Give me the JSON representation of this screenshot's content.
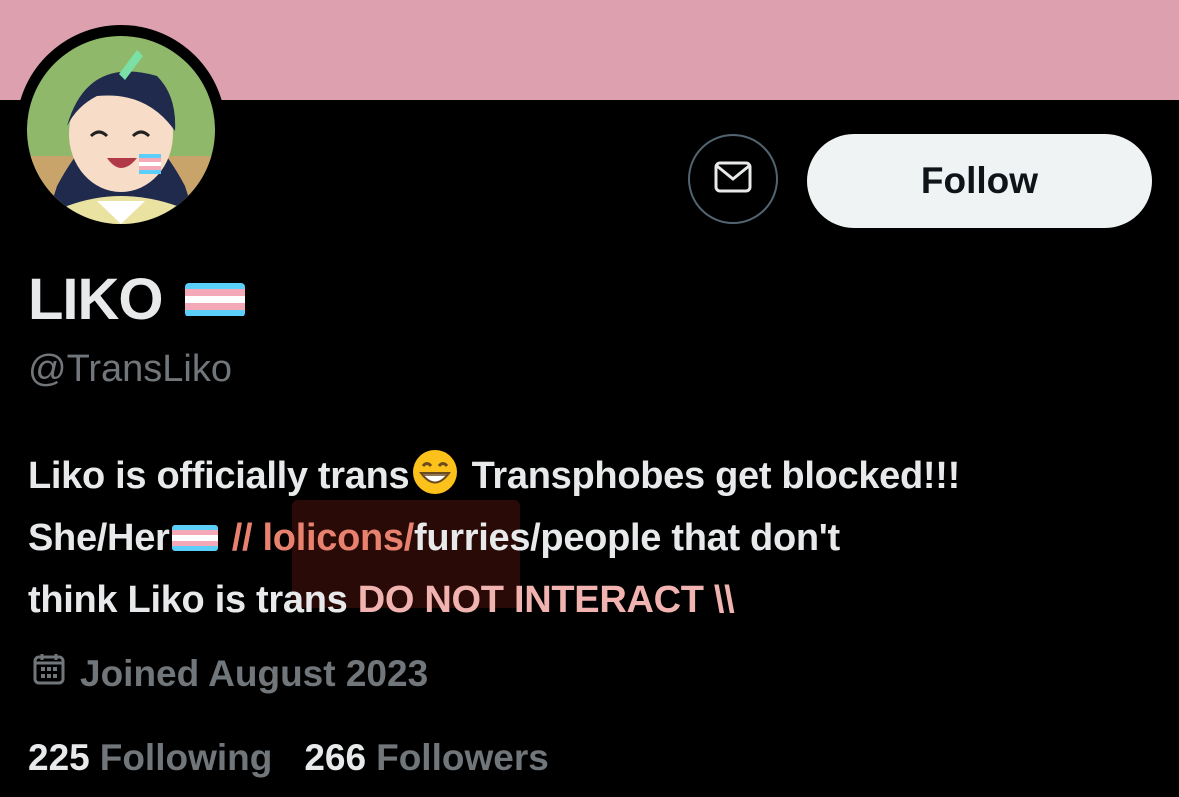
{
  "profile": {
    "display_name": "LIKO",
    "handle": "@TransLiko",
    "follow_label": "Follow",
    "bio": {
      "line1_a": "Liko is officially trans",
      "line1_b": " Transphobes get blocked!!!",
      "line2_a": "She/Her",
      "line2_b": "// lolicons/",
      "line2_c": "furries/people that don't",
      "line3_a": "think Liko is trans ",
      "line3_b": "DO NOT INTERACT \\\\"
    },
    "joined": "Joined August 2023",
    "following_count": "225",
    "following_label": "Following",
    "followers_count": "266",
    "followers_label": "Followers"
  },
  "icons": {
    "message": "envelope-icon",
    "calendar": "calendar-icon",
    "flag": "transgender-flag-icon",
    "emoji": "grinning-face-emoji"
  },
  "colors": {
    "banner": "#dca0af",
    "background": "#000000",
    "text_primary": "#e7e9ea",
    "text_secondary": "#71767b",
    "follow_bg": "#eff3f4",
    "flag_blue": "#5bcefa",
    "flag_pink": "#f5a9b8",
    "flag_white": "#ffffff"
  }
}
